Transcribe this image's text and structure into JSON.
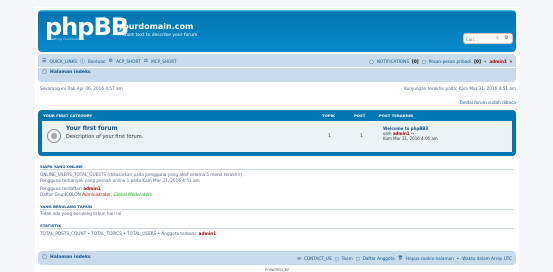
{
  "header": {
    "logo_text": "phpBB",
    "logo_tagline": "creating communities",
    "site_name": "yourdomain.com",
    "site_description": "A short text to describe your forum",
    "search_placeholder": "Cari..."
  },
  "navbar": {
    "quick_links": "QUICK_LINKS",
    "faq": "Bantuan",
    "acp": "ACP_SHORT",
    "mcp": "MCP_SHORT",
    "notifications": "NOTIFICATIONS",
    "notifications_count": "[0]",
    "pm": "Pesan-pesan pribadi",
    "pm_count": "[0]",
    "username": "admin1",
    "breadcrumb_index": "Halaman indeks"
  },
  "info": {
    "current_time": "Sekarang ini Rab Apr 06, 2016 4:57 am",
    "last_visit": "Kunjungan terakhir pada: Kam Mar 31, 2016 4:51 am",
    "mark_read": "Tandai forum sudah dibaca"
  },
  "forum_table": {
    "headers": {
      "category": "YOUR FIRST CATEGORY",
      "topics": "TOPIK",
      "posts": "POST",
      "last_post": "POST TERAKHIR"
    },
    "rows": [
      {
        "title": "Your first forum",
        "description": "Description of your first forum.",
        "topics": "1",
        "posts": "1",
        "last_post_title": "Welcome to phpBB3",
        "last_post_by_label": "oleh",
        "last_post_author": "admin1",
        "last_post_time": "Kam Mar 31, 2016 4:06 am"
      }
    ]
  },
  "who_is_online": {
    "title": "SIAPA YANG ONLINE",
    "line1": "ONLINE_USERS_TOTAL_GUESTS (didasarkan pada pengguna yang aktif selama 5 menit terakhir)",
    "line2": "Pengguna terbanyak yang pernah online 1 pada Kam Mar 31, 2016 4:51 am",
    "registered_label": "Pengguna terdaftar:",
    "registered_user": "admin1",
    "legend_label": "Daftar GrupICOLON",
    "legend_admin": "Administrator",
    "legend_sep": ", ",
    "legend_mods": "Global Moderators"
  },
  "birthdays": {
    "title": "YANG BERULANG TAHUN",
    "text": "Tidak ada yang berulang tahun hari ini"
  },
  "statistics": {
    "title": "STATISTIK",
    "text": "TOTAL_POSTS_COUNT • TOTAL_TOPICS • TOTAL_USERS • Anggota terbaru:",
    "newest_member": "admin1"
  },
  "footer": {
    "index": "Halaman indeks",
    "contact": "CONTACT_US",
    "team": "Team",
    "members": "Daftar Anggota",
    "delete_cookies": "Hapus cookie halaman",
    "timezone": "Waktu dalam Array UTC",
    "powered_by": "POWERED_BY"
  },
  "colors": {
    "header_blue": "#12a3eb",
    "nav_bg": "#cadceb",
    "link": "#105289",
    "admin_red": "#aa0000",
    "mod_green": "#00aa00"
  }
}
